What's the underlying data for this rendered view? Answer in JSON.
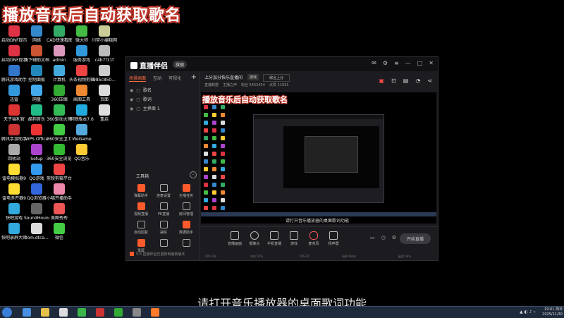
{
  "banner_title": "播放音乐后自动获取歌名",
  "subtitle": "请打开音乐播放器的桌面歌词功能",
  "desktop_icons": [
    {
      "label": "启动DNF提示器",
      "color": "#d34"
    },
    {
      "label": "网络",
      "color": "#38c"
    },
    {
      "label": "CAD快速看图",
      "color": "#3a6"
    },
    {
      "label": "微大师",
      "color": "#4b4"
    },
    {
      "label": "川带小编辑网",
      "color": "#cc9"
    },
    {
      "label": "启动DNF提示器（...",
      "color": "#d34"
    },
    {
      "label": "线下辅助文档",
      "color": "#c53"
    },
    {
      "label": "admin",
      "color": "#d9b"
    },
    {
      "label": "服务游戏",
      "color": "#39d"
    },
    {
      "label": "c4b7f11f",
      "color": "#bbb"
    },
    {
      "label": "腾讯游戏助手",
      "color": "#37c"
    },
    {
      "label": "控制面板",
      "color": "#28b"
    },
    {
      "label": "计算机",
      "color": "#4ad"
    },
    {
      "label": "头条视频剪辑",
      "color": "#e44"
    },
    {
      "label": "985c850...",
      "color": "#ccc"
    },
    {
      "label": "迅雷",
      "color": "#39d"
    },
    {
      "label": "网盘",
      "color": "#4ae"
    },
    {
      "label": "360压缩",
      "color": "#3a3"
    },
    {
      "label": "画图工具",
      "color": "#e83"
    },
    {
      "label": "页面",
      "color": "#ddd"
    },
    {
      "label": "天子福利官",
      "color": "#d33"
    },
    {
      "label": "酷狗音乐",
      "color": "#2b8"
    },
    {
      "label": "360驱动大师",
      "color": "#3b5"
    },
    {
      "label": "剪映版本7.6",
      "color": "#2ad"
    },
    {
      "label": "重启",
      "color": "#ddd"
    },
    {
      "label": "腾讯手游助手",
      "color": "#c33"
    },
    {
      "label": "WPS Office",
      "color": "#e33"
    },
    {
      "label": "360安全卫士",
      "color": "#4c4"
    },
    {
      "label": "WeGame",
      "color": "#5ad"
    },
    {
      "label": "回收站",
      "color": "#aaa"
    },
    {
      "label": "Setup",
      "color": "#a4c"
    },
    {
      "label": "360安全浏览器",
      "color": "#3b3"
    },
    {
      "label": "QQ音乐",
      "color": "#fc3"
    },
    {
      "label": "雷电模拟器9",
      "color": "#fd3"
    },
    {
      "label": "QQ游戏",
      "color": "#39e"
    },
    {
      "label": "剪映剪辑平台",
      "color": "#e44"
    },
    {
      "label": "雷电多开器9",
      "color": "#fd3"
    },
    {
      "label": "QQ浏览器",
      "color": "#36d"
    },
    {
      "label": "小喵开播助手",
      "color": "#e8a"
    },
    {
      "label": "快吧游戏",
      "color": "#3ad"
    },
    {
      "label": "SoundHound",
      "color": "#666"
    },
    {
      "label": "美图秀秀",
      "color": "#e55"
    },
    {
      "label": "快吧录屏大师",
      "color": "#3ad"
    },
    {
      "label": "com.dtca...",
      "color": "#ddd"
    },
    {
      "label": "微信",
      "color": "#4c4"
    }
  ],
  "app": {
    "name": "直播伴侣",
    "badge": "旗舰",
    "tabs": [
      "场景画面",
      "互动",
      "可视化"
    ],
    "scenes": [
      "歌名",
      "歌词",
      "主界面 1"
    ],
    "tools_header": "工具箱",
    "tools": [
      {
        "label": "弹幕助手",
        "style": "or"
      },
      {
        "label": "连麦设置",
        "style": "ol"
      },
      {
        "label": "主播任务",
        "style": "or"
      },
      {
        "label": "视频直播",
        "style": "or"
      },
      {
        "label": "PK直播",
        "style": "ol"
      },
      {
        "label": "房间管理",
        "style": "ol"
      },
      {
        "label": "自动回复",
        "style": "ol"
      },
      {
        "label": "抽奖",
        "style": "ol"
      },
      {
        "label": "数据助手",
        "style": "or"
      },
      {
        "label": "录屏",
        "style": "or"
      },
      {
        "label": "",
        "style": "ol"
      },
      {
        "label": "",
        "style": "ol"
      }
    ],
    "left_footer": "5.6 直播伴侣已更新到最新版本",
    "stream_title": "上分加分快乐直播间",
    "stream_tag": "游戏",
    "category": "综合上分",
    "meta": [
      "直播数据",
      "主播之声",
      "粉丝 5452454",
      "点赞 11931"
    ],
    "preview_title": "播放音乐后自动获取歌名",
    "preview_sub": "请打开音乐播放器的桌面歌词功能",
    "controls": [
      "直播画面",
      "摄像头",
      "手机直播",
      "游戏",
      "麦克风",
      "扬声器"
    ],
    "golive": "开始直播",
    "status": [
      "CPU 3%",
      "内存 52%",
      "FPS 30",
      "码率 0kb/s",
      "延迟 0ms"
    ]
  },
  "clock": {
    "time": "19:01 周日",
    "date": "2025/11/30"
  }
}
